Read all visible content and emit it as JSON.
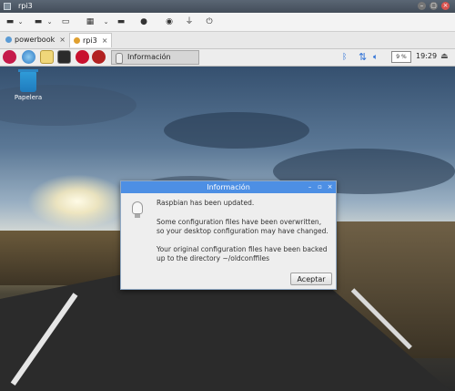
{
  "window": {
    "title": "rpi3"
  },
  "toolbar": {
    "items": [
      {
        "icon": "folder-icon"
      },
      {
        "icon": "chevron-down-icon"
      },
      {
        "icon": "copy-icon"
      },
      {
        "icon": "chevron-down-icon"
      },
      {
        "icon": "window-icon"
      },
      {
        "icon": "keyboard-icon"
      },
      {
        "icon": "chevron-down-icon"
      },
      {
        "icon": "screen-icon"
      },
      {
        "icon": "record-icon"
      },
      {
        "icon": "usb-icon"
      },
      {
        "icon": "power-icon"
      }
    ]
  },
  "tabs": [
    {
      "label": "powerbook",
      "close": "×"
    },
    {
      "label": "rpi3",
      "close": "×"
    }
  ],
  "panel": {
    "taskbar_label": "Información",
    "cpu": "9 %",
    "clock": "19:29",
    "eject": "⏏"
  },
  "desktop": {
    "trash_label": "Papelera"
  },
  "dialog": {
    "title": "Información",
    "line1": "Raspbian has been updated.",
    "line2": "Some configuration files have been overwritten, so your desktop configuration may have changed.",
    "line3": "Your original configuration files have been backed up to the directory ~/oldconffiles",
    "button": "Aceptar"
  },
  "colors": {
    "dialog_title": "#4d8fe4",
    "tray_accent": "#2a6fd6"
  }
}
